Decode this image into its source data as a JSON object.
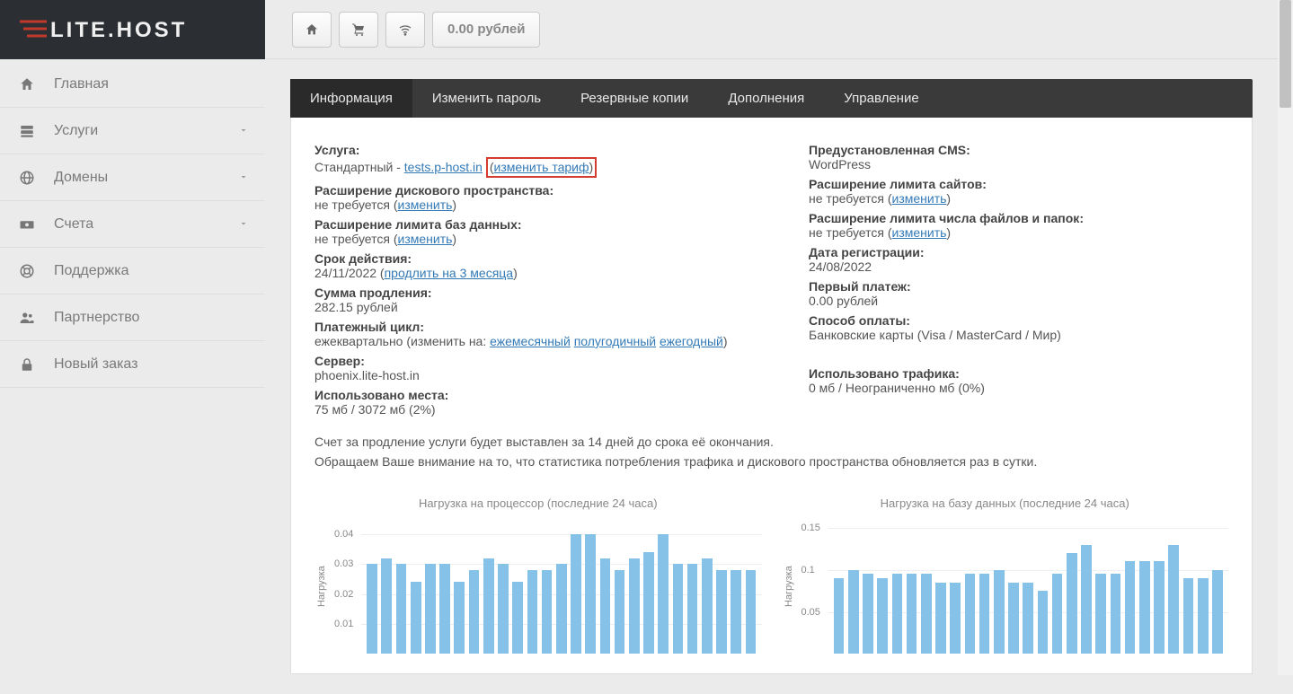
{
  "brand": "LITE.HOST",
  "balance": "0.00 рублей",
  "sidebar": {
    "items": [
      {
        "icon": "home",
        "label": "Главная",
        "chevron": false
      },
      {
        "icon": "server",
        "label": "Услуги",
        "chevron": true
      },
      {
        "icon": "globe",
        "label": "Домены",
        "chevron": true
      },
      {
        "icon": "money",
        "label": "Счета",
        "chevron": true
      },
      {
        "icon": "life-ring",
        "label": "Поддержка",
        "chevron": false
      },
      {
        "icon": "users",
        "label": "Партнерство",
        "chevron": false
      },
      {
        "icon": "lock",
        "label": "Новый заказ",
        "chevron": false
      }
    ]
  },
  "tabs": [
    {
      "label": "Информация",
      "active": true
    },
    {
      "label": "Изменить пароль",
      "active": false
    },
    {
      "label": "Резервные копии",
      "active": false
    },
    {
      "label": "Дополнения",
      "active": false
    },
    {
      "label": "Управление",
      "active": false
    }
  ],
  "info": {
    "service_label": "Услуга:",
    "service_plan": "Стандартный - ",
    "service_domain": "tests.p-host.in",
    "change_tariff_open": "(",
    "change_tariff": "изменить тариф",
    "change_tariff_close": ")",
    "disk_ext_label": "Расширение дискового пространства:",
    "disk_ext_value": "не требуется (",
    "disk_ext_link": "изменить",
    "close_paren": ")",
    "db_ext_label": "Расширение лимита баз данных:",
    "db_ext_value": "не требуется (",
    "db_ext_link": "изменить",
    "expiry_label": "Срок действия:",
    "expiry_value": "24/11/2022 (",
    "expiry_link": "продлить на 3 месяца",
    "renewal_sum_label": "Сумма продления:",
    "renewal_sum_value": "282.15 рублей",
    "cycle_label": "Платежный цикл:",
    "cycle_prefix": "ежеквартально (изменить на: ",
    "cycle_monthly": "ежемесячный",
    "cycle_semi": "полугодичный",
    "cycle_annual": "ежегодный",
    "server_label": "Сервер:",
    "server_value": "phoenix.lite-host.in",
    "disk_used_label": "Использовано места:",
    "disk_used_value": "75 мб / 3072 мб (2%)",
    "cms_label": "Предустановленная CMS:",
    "cms_value": "WordPress",
    "sites_ext_label": "Расширение лимита сайтов:",
    "sites_ext_value": "не требуется (",
    "sites_ext_link": "изменить",
    "files_ext_label": "Расширение лимита числа файлов и папок:",
    "files_ext_value": "не требуется (",
    "files_ext_link": "изменить",
    "reg_date_label": "Дата регистрации:",
    "reg_date_value": "24/08/2022",
    "first_pay_label": "Первый платеж:",
    "first_pay_value": "0.00 рублей",
    "pay_method_label": "Способ оплаты:",
    "pay_method_value": "Банковские карты (Visa / MasterCard / Мир)",
    "traffic_label": "Использовано трафика:",
    "traffic_value": "0 мб / Неограниченно мб (0%)"
  },
  "notes": {
    "line1": "Счет за продление услуги будет выставлен за 14 дней до срока её окончания.",
    "line2": "Обращаем Ваше внимание на то, что статистика потребления трафика и дискового пространства обновляется раз в сутки."
  },
  "chart_data": [
    {
      "type": "bar",
      "title": "Нагрузка на процессор (последние 24 часа)",
      "ylabel": "Нагрузка",
      "ylim": [
        0,
        0.045
      ],
      "yticks": [
        0.01,
        0.02,
        0.03,
        0.04
      ],
      "values": [
        0.03,
        0.032,
        0.03,
        0.024,
        0.03,
        0.03,
        0.024,
        0.028,
        0.032,
        0.03,
        0.024,
        0.028,
        0.028,
        0.03,
        0.04,
        0.04,
        0.032,
        0.028,
        0.032,
        0.034,
        0.04,
        0.03,
        0.03,
        0.032,
        0.028,
        0.028,
        0.028
      ]
    },
    {
      "type": "bar",
      "title": "Нагрузка на базу данных (последние 24 часа)",
      "ylabel": "Нагрузка",
      "ylim": [
        0,
        0.16
      ],
      "yticks": [
        0.05,
        0.1,
        0.15
      ],
      "values": [
        0.09,
        0.1,
        0.095,
        0.09,
        0.095,
        0.095,
        0.095,
        0.085,
        0.085,
        0.095,
        0.095,
        0.1,
        0.085,
        0.085,
        0.075,
        0.095,
        0.12,
        0.13,
        0.095,
        0.095,
        0.11,
        0.11,
        0.11,
        0.13,
        0.09,
        0.09,
        0.1
      ]
    }
  ]
}
